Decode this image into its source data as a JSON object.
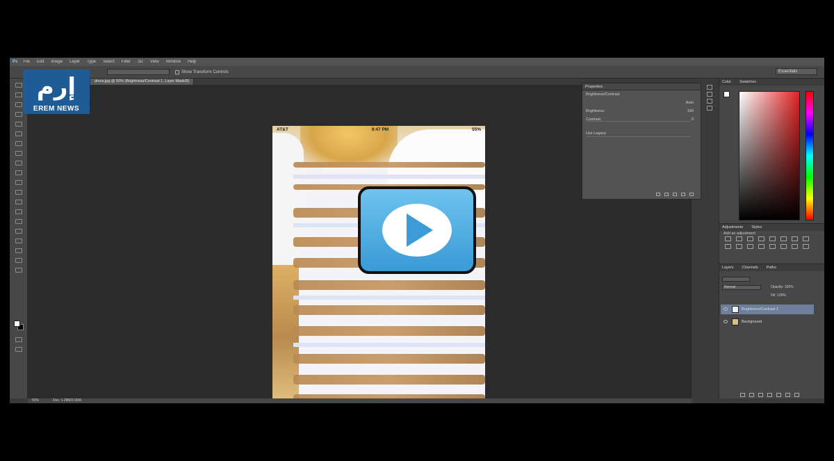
{
  "watermark": {
    "logo_text": "إرم",
    "caption": "EREM NEWS"
  },
  "app": {
    "logo": "Ps",
    "menu": [
      "File",
      "Edit",
      "Image",
      "Layer",
      "Type",
      "Select",
      "Filter",
      "3D",
      "View",
      "Window",
      "Help"
    ],
    "workspace": "Essentials",
    "auto_select": "Show Transform Controls"
  },
  "document": {
    "tab_title": "dress.jpg @ 50% (Brightness/Contrast 1, Layer Mask/8)",
    "ios_time": "9:47 PM",
    "ios_carrier": "AT&T",
    "ios_battery": "55%"
  },
  "properties": {
    "header": "Properties",
    "adjustment": "Brightness/Contrast",
    "auto_label": "Auto",
    "brightness_label": "Brightness:",
    "brightness_value": "150",
    "contrast_label": "Contrast:",
    "contrast_value": "0",
    "legacy_label": "Use Legacy"
  },
  "right_panels": {
    "color_tabs": [
      "Color",
      "Swatches"
    ],
    "adjust_tabs": [
      "Adjustments",
      "Styles"
    ],
    "adjust_title": "Add an adjustment",
    "layers_tabs": [
      "Layers",
      "Channels",
      "Paths"
    ],
    "blend_mode": "Normal",
    "opacity": "Opacity: 100%",
    "fill": "Fill: 100%",
    "layers": [
      {
        "name": "Brightness/Contrast 1",
        "selected": true
      },
      {
        "name": "Background",
        "selected": false
      }
    ]
  },
  "status": {
    "zoom": "50%",
    "doc_size": "Doc: 1.28M/2.56M"
  },
  "overlay": {
    "icon": "play-icon"
  },
  "colors": {
    "panel_bg": "#535353",
    "canvas_bg": "#2b2b2b",
    "play_blue": "#4aa9e0",
    "watermark_blue": "#1f5c96"
  }
}
